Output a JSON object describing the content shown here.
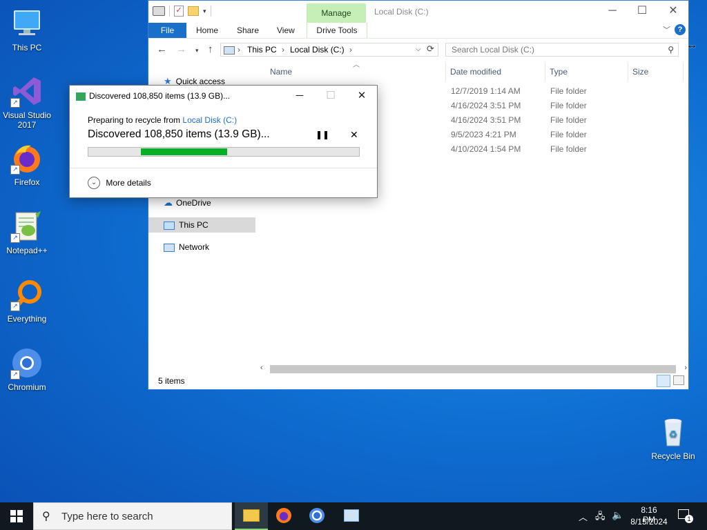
{
  "desktop": {
    "icons": [
      {
        "label": "This PC",
        "icon": "this-pc-icon"
      },
      {
        "label": "Visual Studio 2017",
        "icon": "visual-studio-icon"
      },
      {
        "label": "Firefox",
        "icon": "firefox-icon"
      },
      {
        "label": "Notepad++",
        "icon": "notepad-plus-plus-icon"
      },
      {
        "label": "Everything",
        "icon": "everything-search-icon"
      },
      {
        "label": "Chromium",
        "icon": "chromium-icon"
      },
      {
        "label": "Recycle Bin",
        "icon": "recycle-bin-icon"
      }
    ]
  },
  "explorer": {
    "title": "Local Disk (C:)",
    "contextual_tab": "Manage",
    "ribbon_tabs": [
      "File",
      "Home",
      "Share",
      "View",
      "Drive Tools"
    ],
    "breadcrumb": [
      "This PC",
      "Local Disk (C:)"
    ],
    "search_placeholder": "Search Local Disk (C:)",
    "columns": [
      "Name",
      "Date modified",
      "Type",
      "Size"
    ],
    "rows": [
      {
        "date": "12/7/2019 1:14 AM",
        "type": "File folder"
      },
      {
        "date": "4/16/2024 3:51 PM",
        "type": "File folder"
      },
      {
        "date": "4/16/2024 3:51 PM",
        "type": "File folder"
      },
      {
        "date": "9/5/2023 4:21 PM",
        "type": "File folder"
      },
      {
        "date": "4/10/2024 1:54 PM",
        "type": "File folder"
      }
    ],
    "nav_pane": [
      "Quick access",
      "OneDrive",
      "This PC",
      "Network"
    ],
    "status": "5 items"
  },
  "dialog": {
    "title": "Discovered 108,850 items (13.9 GB)...",
    "preparing_prefix": "Preparing to recycle from ",
    "preparing_link": "Local Disk (C:)",
    "main_text": "Discovered 108,850 items (13.9 GB)...",
    "progress_fraction": 0.32,
    "more_details": "More details"
  },
  "taskbar": {
    "search_placeholder": "Type here to search",
    "time": "8:16 PM",
    "date": "8/15/2024",
    "notification_count": "1"
  },
  "colors": {
    "accent": "#1a6fc9",
    "manage_tab": "#c6efb8",
    "progress": "#06b025"
  }
}
